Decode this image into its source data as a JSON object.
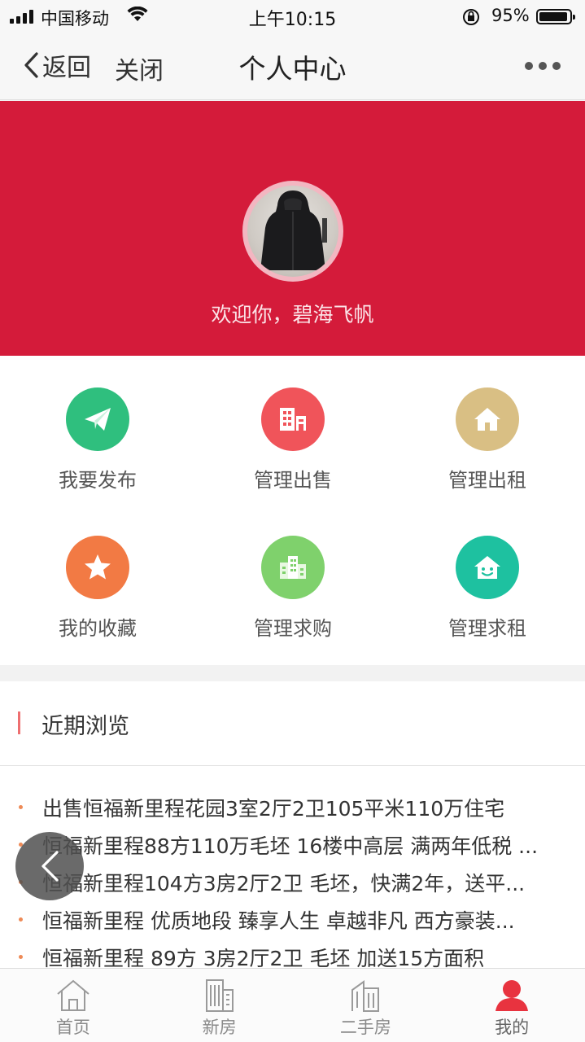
{
  "status_bar": {
    "carrier": "中国移动",
    "time": "上午10:15",
    "battery": "95%"
  },
  "nav": {
    "back_label": "返回",
    "close_label": "关闭",
    "title": "个人中心"
  },
  "profile": {
    "welcome": "欢迎你，碧海飞帆",
    "banner_color": "#d41b3a"
  },
  "menu": [
    {
      "label": "我要发布",
      "icon": "paper-plane-icon",
      "color": "#2fbf7e"
    },
    {
      "label": "管理出售",
      "icon": "building-sale-icon",
      "color": "#f0545a"
    },
    {
      "label": "管理出租",
      "icon": "house-icon",
      "color": "#d9bf84"
    },
    {
      "label": "我的收藏",
      "icon": "star-icon",
      "color": "#f27a44"
    },
    {
      "label": "管理求购",
      "icon": "buildings-icon",
      "color": "#7fd16c"
    },
    {
      "label": "管理求租",
      "icon": "smiling-house-icon",
      "color": "#1ec1a0"
    }
  ],
  "recent": {
    "title": "近期浏览",
    "items": [
      "出售恒福新里程花园3室2厅2卫105平米110万住宅",
      "恒福新里程88方110万毛坯 16楼中高层 满两年低税 ...",
      "恒福新里程104方3房2厅2卫 毛坯，快满2年，送平...",
      "恒福新里程 优质地段 臻享人生 卓越非凡 西方豪装...",
      "恒福新里程 89方 3房2厅2卫 毛坯 加送15方面积"
    ]
  },
  "tabs": [
    {
      "label": "首页",
      "icon": "home-icon"
    },
    {
      "label": "新房",
      "icon": "new-building-icon"
    },
    {
      "label": "二手房",
      "icon": "second-hand-building-icon"
    },
    {
      "label": "我的",
      "icon": "user-icon",
      "active_color": "#e8333f"
    }
  ]
}
